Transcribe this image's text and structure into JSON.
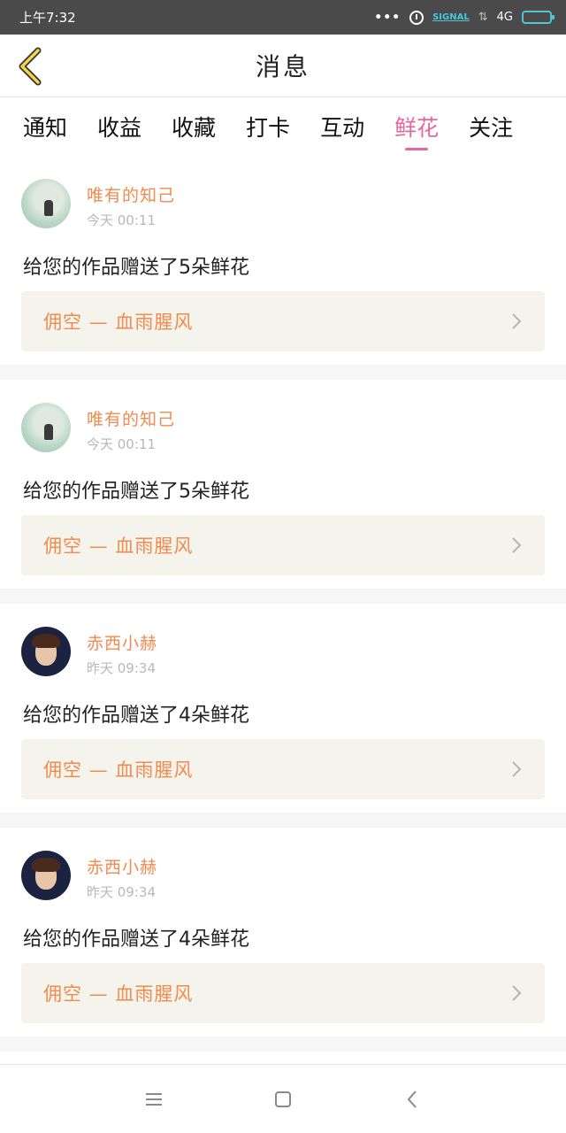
{
  "status_bar": {
    "time": "上午7:32",
    "signal_label": "SIGNAL",
    "network": "4G",
    "icons": [
      "more-dots-icon",
      "alarm-icon",
      "data-arrows-icon",
      "battery-icon"
    ]
  },
  "header": {
    "title": "消息",
    "back_icon": "chevron-left-icon"
  },
  "tabs": [
    {
      "label": "通知",
      "active": false
    },
    {
      "label": "收益",
      "active": false
    },
    {
      "label": "收藏",
      "active": false
    },
    {
      "label": "打卡",
      "active": false
    },
    {
      "label": "互动",
      "active": false
    },
    {
      "label": "鲜花",
      "active": true
    },
    {
      "label": "关注",
      "active": false
    }
  ],
  "messages": [
    {
      "user": "唯有的知己",
      "time": "今天 00:11",
      "text": "给您的作品赠送了5朵鲜花",
      "work": "佣空 — 血雨腥风"
    },
    {
      "user": "唯有的知己",
      "time": "今天 00:11",
      "text": "给您的作品赠送了5朵鲜花",
      "work": "佣空 — 血雨腥风"
    },
    {
      "user": "赤西小赫",
      "time": "昨天 09:34",
      "text": "给您的作品赠送了4朵鲜花",
      "work": "佣空 — 血雨腥风"
    },
    {
      "user": "赤西小赫",
      "time": "昨天 09:34",
      "text": "给您的作品赠送了4朵鲜花",
      "work": "佣空 — 血雨腥风"
    }
  ],
  "nav_bar": {
    "icons": [
      "menu-icon",
      "home-square-icon",
      "back-triangle-icon"
    ]
  },
  "colors": {
    "accent_pink": "#e8679a",
    "accent_orange": "#f08a4f",
    "back_arrow": "#f2d44a"
  }
}
